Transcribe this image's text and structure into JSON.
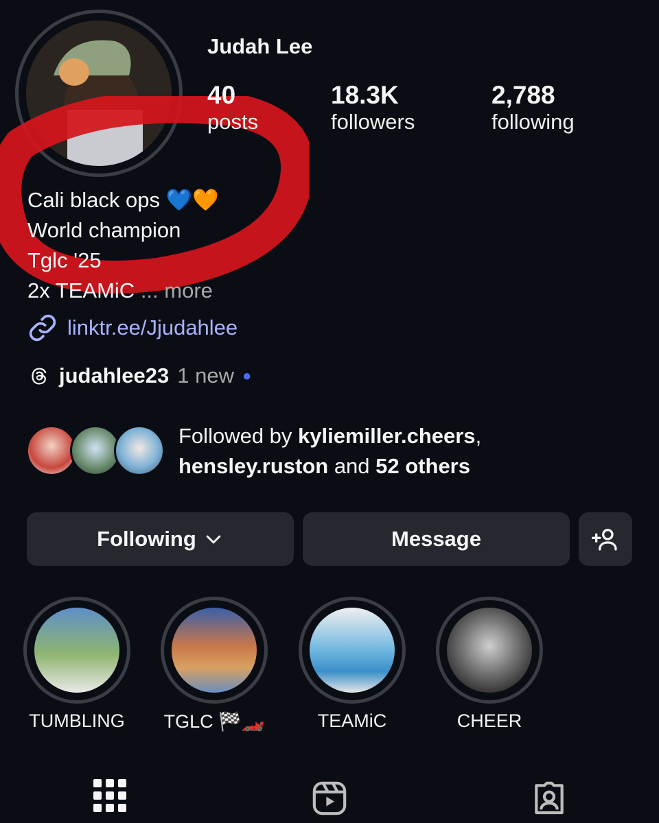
{
  "profile": {
    "name": "Judah Lee",
    "stats": [
      {
        "value": "40",
        "label": "posts"
      },
      {
        "value": "18.3K",
        "label": "followers"
      },
      {
        "value": "2,788",
        "label": "following"
      }
    ],
    "bio_lines": [
      "Cali black ops 💙🧡",
      "World champion",
      "Tglc '25",
      "2x TEAMiC"
    ],
    "bio_more": "... more",
    "link": "linktr.ee/Jjudahlee",
    "threads_handle": "judahlee23",
    "threads_new": "1 new",
    "followed_by": {
      "prefix": "Followed by ",
      "user1": "kyliemiller.cheers",
      "sep": ",",
      "user2": "hensley.ruston",
      "and": " and ",
      "others": "52 others"
    }
  },
  "actions": {
    "following_label": "Following",
    "message_label": "Message",
    "add_user_icon": "add-person-icon"
  },
  "highlights": [
    {
      "label": "TUMBLING"
    },
    {
      "label": "TGLC 🏁🏎️"
    },
    {
      "label": "TEAMiC"
    },
    {
      "label": "CHEER"
    }
  ],
  "tabs": [
    {
      "icon": "grid-icon"
    },
    {
      "icon": "reels-icon"
    },
    {
      "icon": "tagged-icon"
    }
  ]
}
